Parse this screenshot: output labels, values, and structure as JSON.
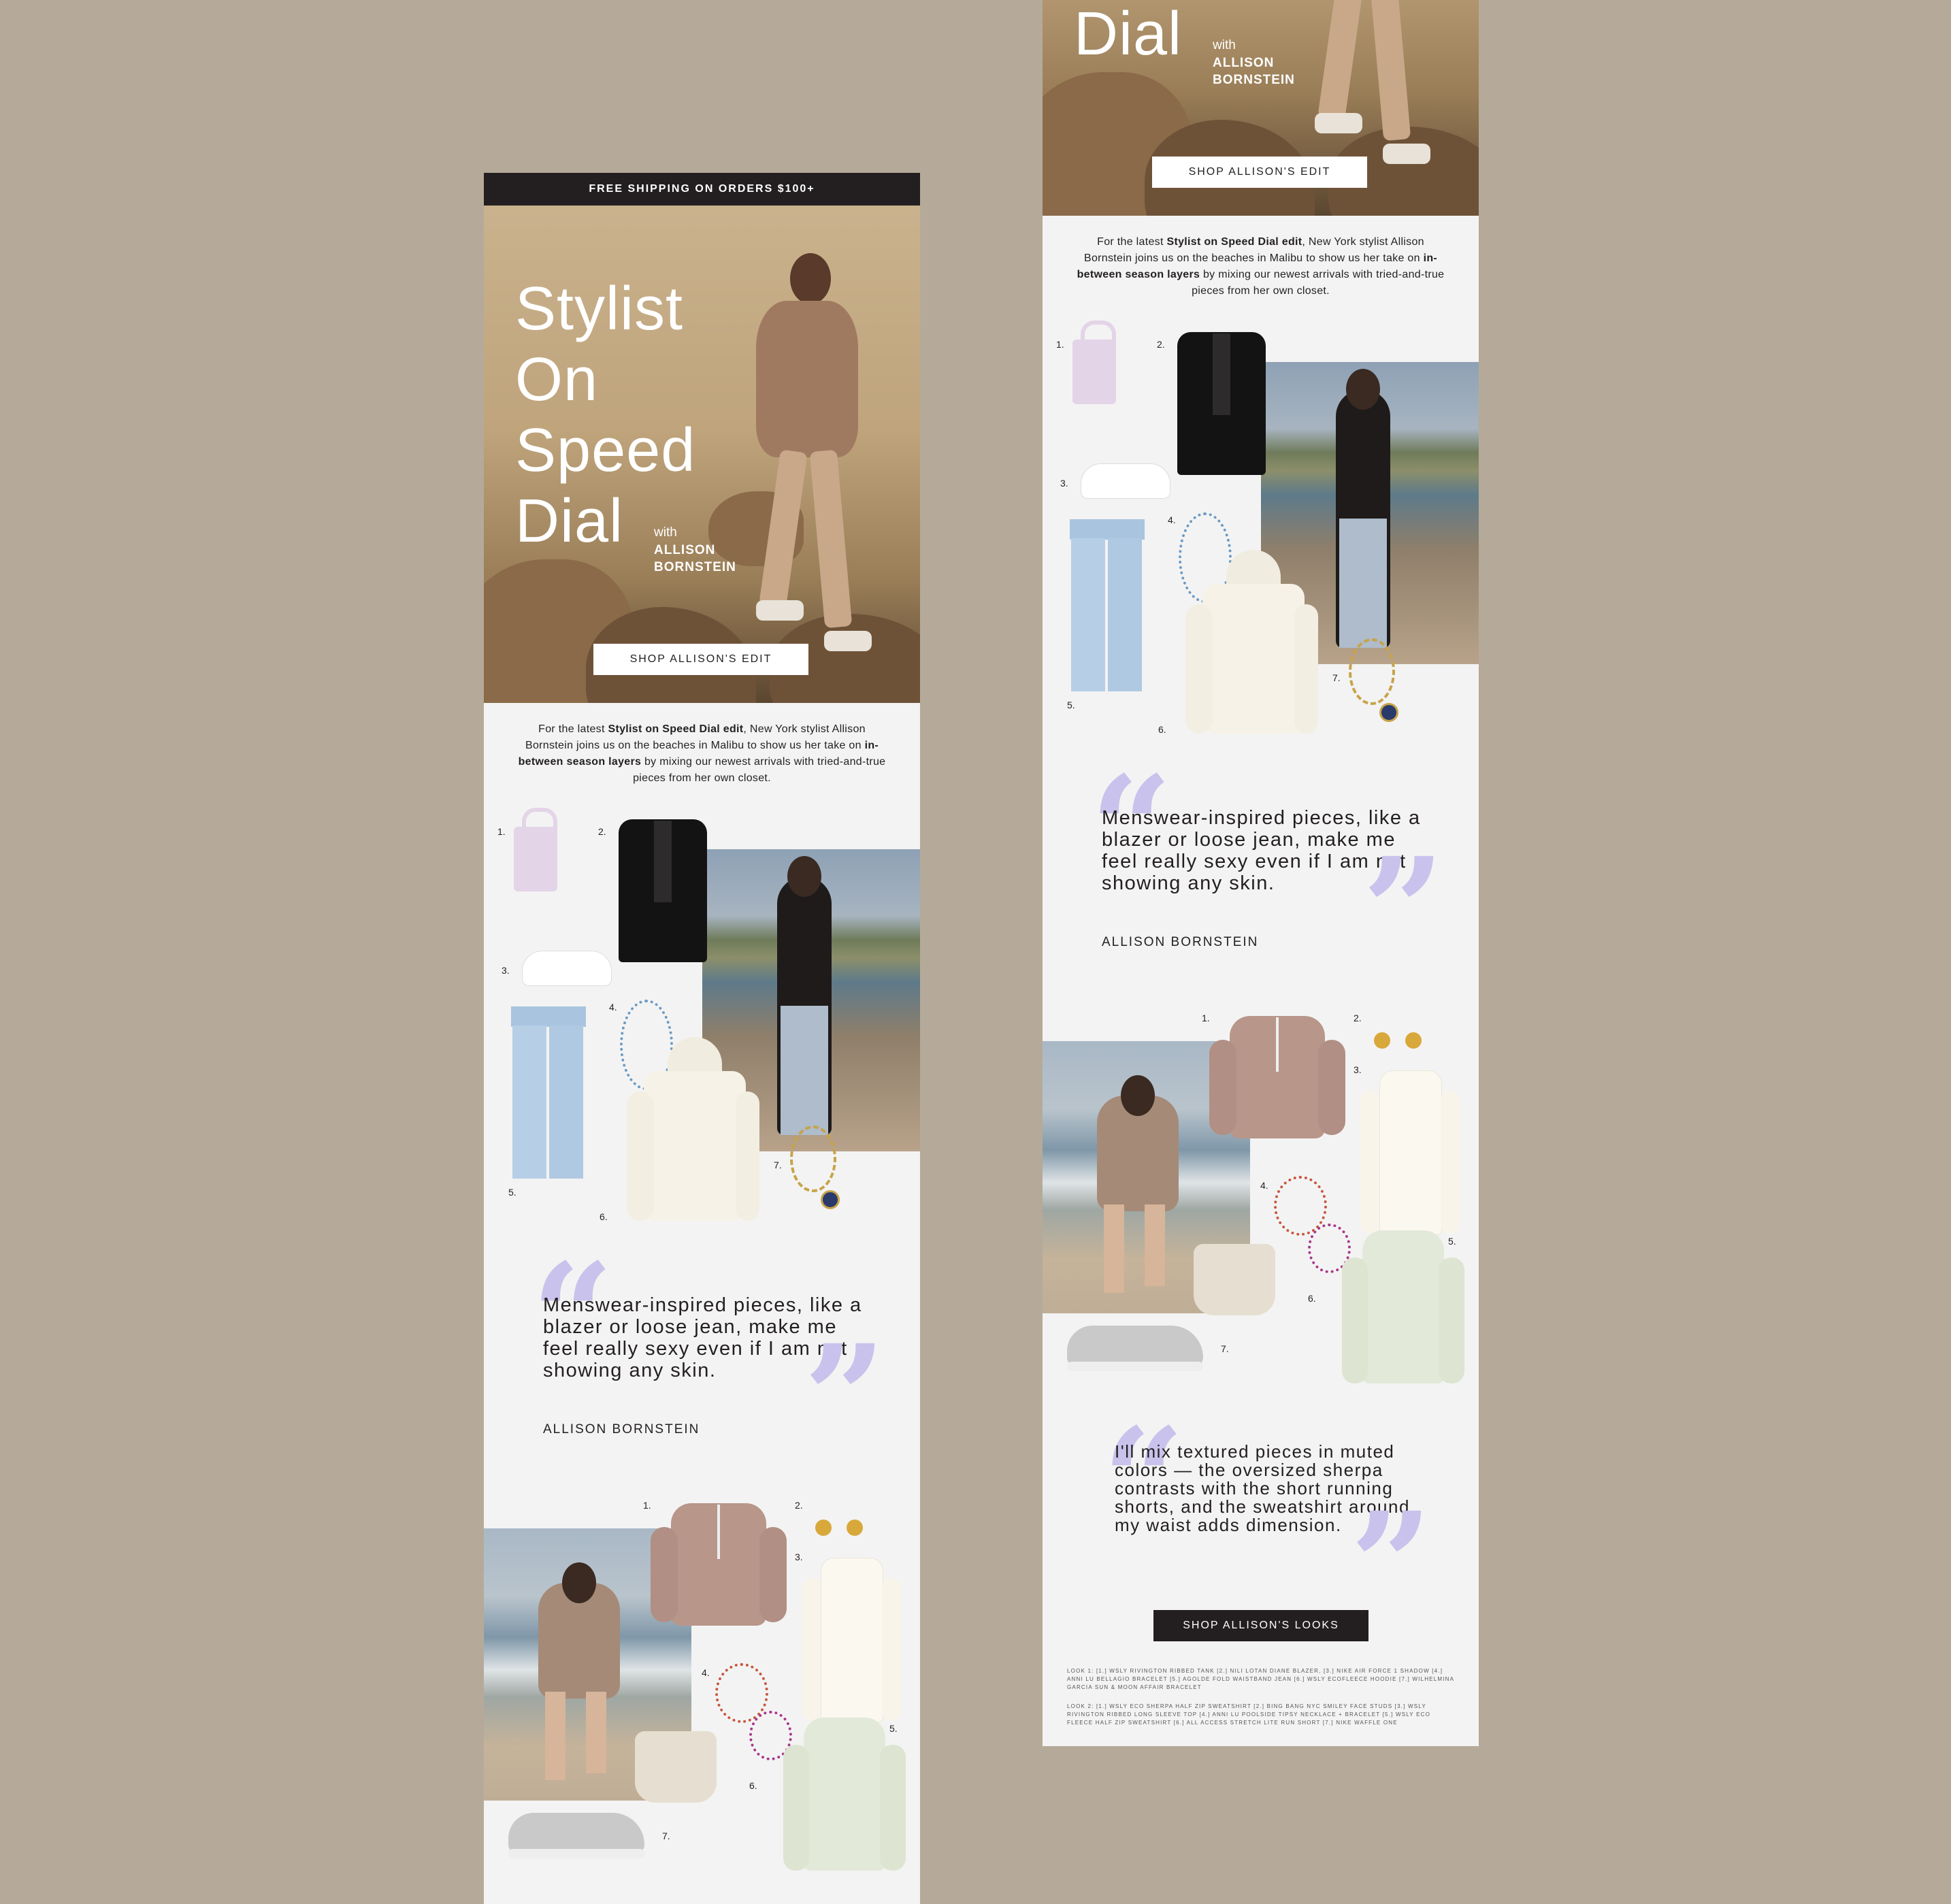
{
  "email": {
    "shipping_banner": "FREE SHIPPING ON ORDERS $100+",
    "hero": {
      "title_lines": [
        "Stylist",
        "On",
        "Speed",
        "Dial"
      ],
      "with": "with",
      "name_lines": [
        "ALLISON",
        "BORNSTEIN"
      ],
      "cta": "SHOP ALLISON'S EDIT"
    },
    "intro": {
      "p1": "For the latest ",
      "b1": "Stylist on Speed Dial edit",
      "p2": ", New York stylist Allison Bornstein joins us on the beaches in Malibu to show us her take on ",
      "b2": "in-between season layers",
      "p3": " by mixing our newest arrivals with tried-and-true pieces from her own closet."
    },
    "look1": {
      "numbers": [
        "1.",
        "2.",
        "3.",
        "4.",
        "5.",
        "6.",
        "7."
      ]
    },
    "quote1": {
      "open": "“",
      "close": "”",
      "text": "Menswear-inspired pieces, like a blazer or loose jean, make me feel really sexy even if I am not showing any skin.",
      "author": "ALLISON BORNSTEIN"
    },
    "look2": {
      "numbers": [
        "1.",
        "2.",
        "3.",
        "4.",
        "5.",
        "6.",
        "7."
      ]
    },
    "quote2": {
      "open": "“",
      "close": "”",
      "text": "I'll mix textured pieces in muted colors — the oversized sherpa contrasts with the short running shorts, and the sweatshirt around my waist adds dimension."
    },
    "cta_bottom": "SHOP ALLISON'S LOOKS",
    "credits": {
      "look1": "LOOK 1: [1.] WSLY RIVINGTON RIBBED TANK [2.] NILI LOTAN DIANE BLAZER, [3.] NIKE AIR FORCE 1 SHADOW [4.] ANNI LU BELLAGIO BRACELET [5.] AGOLDE FOLD WAISTBAND JEAN [6.] WSLY ECOFLEECE HOODIE [7.] WILHELMINA GARCIA SUN & MOON AFFAIR BRACELET",
      "look2": "LOOK 2: [1.] WSLY ECO SHERPA HALF ZIP SWEATSHIRT [2.] BING BANG NYC SMILEY FACE STUDS [3.] WSLY RIVINGTON RIBBED LONG SLEEVE TOP [4.] ANNI LU POOLSIDE TIPSY NECKLACE + BRACELET [5.] WSLY ECO FLEECE HALF ZIP SWEATSHIRT [6.] ALL ACCESS STRETCH LITE RUN SHORT [7.] NIKE WAFFLE ONE"
    }
  },
  "colors": {
    "background": "#b5aa99",
    "email_bg": "#f3f3f3",
    "dark": "#231f20",
    "quote_accent": "#c9c2ec"
  }
}
